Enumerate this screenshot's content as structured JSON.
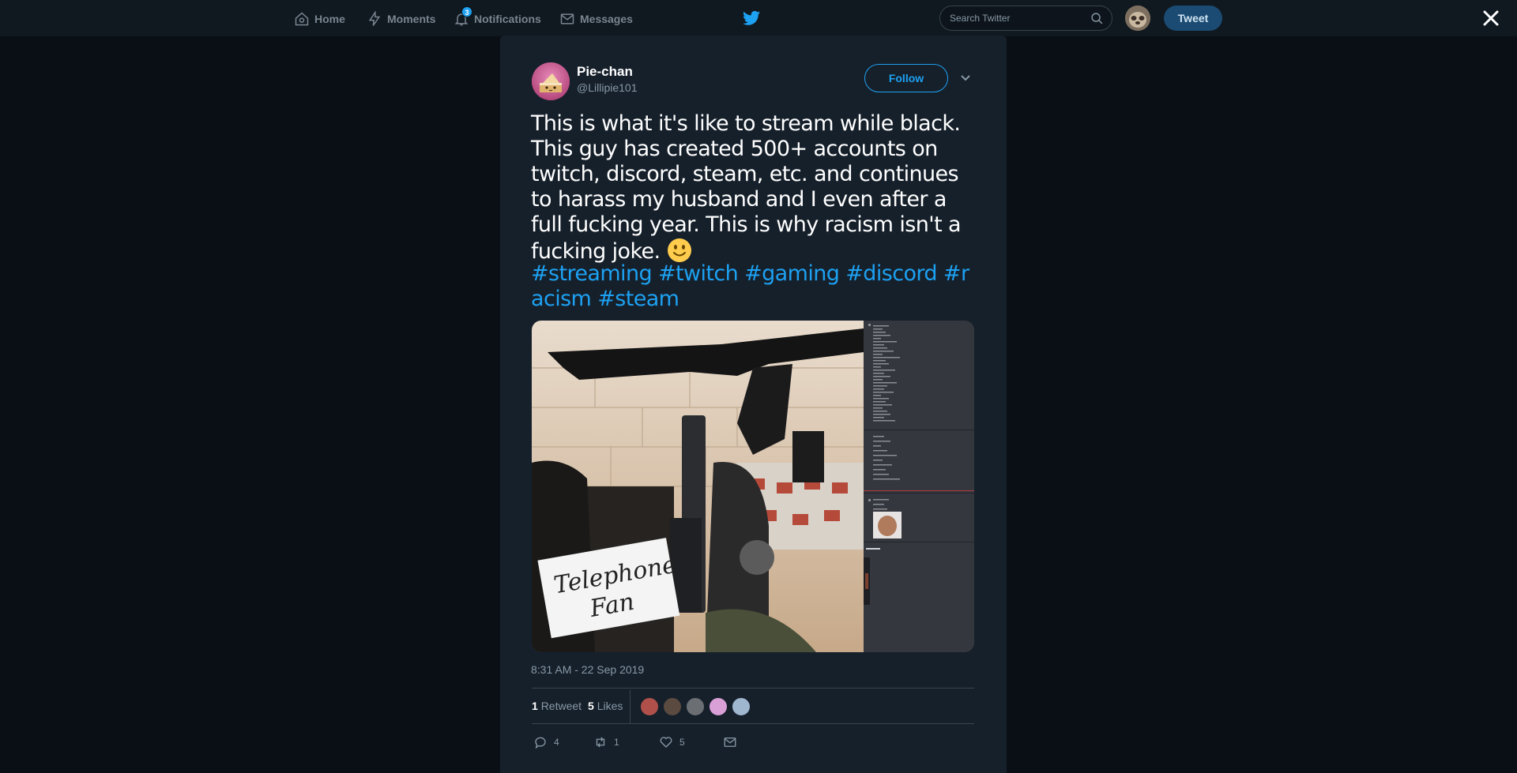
{
  "nav": {
    "home_label": "Home",
    "moments_label": "Moments",
    "notifications_label": "Notifications",
    "notifications_count": "3",
    "messages_label": "Messages",
    "search_placeholder": "Search Twitter",
    "tweet_button_label": "Tweet"
  },
  "tweet": {
    "author_name": "Pie-chan",
    "author_handle": "@Lillipie101",
    "follow_label": "Follow",
    "text": "This is what it's like to stream while black. This guy has created 500+ accounts on twitch, discord, steam, etc. and continues to harass my husband and I even after a full fucking year. This is why racism isn't a fucking joke.",
    "emoji": "slightly-smiling-face",
    "hashtags": [
      "#streaming",
      "#twitch",
      "#gaming",
      "#discord",
      "#racism",
      "#steam"
    ],
    "timestamp": "8:31 AM - 22 Sep 2019",
    "media_note_text": "Telephone Fan",
    "retweets_count": "1",
    "retweets_label": "Retweet",
    "likes_count": "5",
    "likes_label": "Likes",
    "likers": [
      {
        "name": "liker-1",
        "color": "#b0504a"
      },
      {
        "name": "liker-2",
        "color": "#5a4a40"
      },
      {
        "name": "liker-3",
        "color": "#6b6f74"
      },
      {
        "name": "liker-4",
        "color": "#d9a0d8"
      },
      {
        "name": "liker-5",
        "color": "#9fb7cf"
      }
    ],
    "actions": {
      "reply_count": "4",
      "retweet_count": "1",
      "like_count": "5"
    }
  },
  "colors": {
    "accent": "#1da1f2",
    "modal_bg": "#16202b",
    "page_bg": "#0a0f15"
  }
}
